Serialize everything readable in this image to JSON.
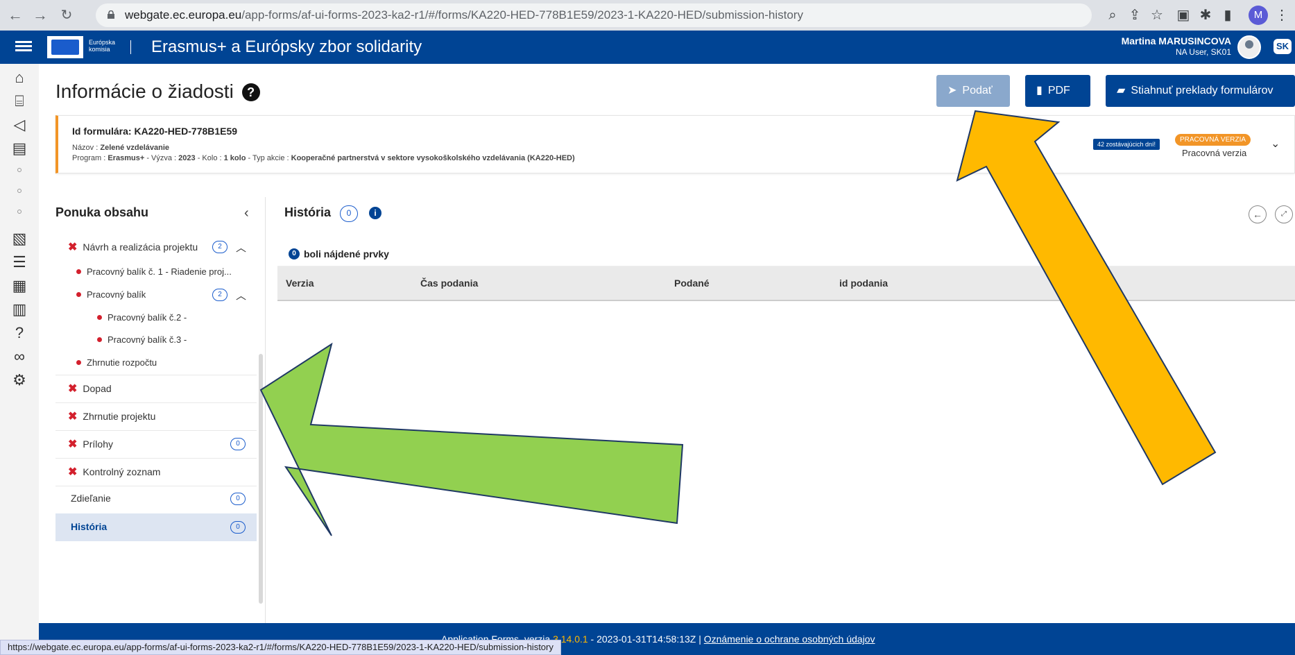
{
  "browser": {
    "url_host": "webgate.ec.europa.eu",
    "url_path": "/app-forms/af-ui-forms-2023-ka2-r1/#/forms/KA220-HED-778B1E59/2023-1-KA220-HED/submission-history",
    "profile_initial": "M",
    "status_url": "https://webgate.ec.europa.eu/app-forms/af-ui-forms-2023-ka2-r1/#/forms/KA220-HED-778B1E59/2023-1-KA220-HED/submission-history"
  },
  "header": {
    "logo_line1": "Európska",
    "logo_line2": "komisia",
    "app_title": "Erasmus+ a Európsky zbor solidarity",
    "user_name": "Martina MARUSINCOVA",
    "user_role": "NA User, SK01",
    "language": "SK"
  },
  "page": {
    "title": "Informácie o žiadosti",
    "help_icon": "?"
  },
  "actions": {
    "submit_label": "Podať",
    "pdf_label": "PDF",
    "translate_label": "Stiahnuť preklady formulárov"
  },
  "form_info": {
    "id_label": "Id formulára: KA220-HED-778B1E59",
    "name_prefix": "Názov : ",
    "name_value": "Zelené vzdelávanie",
    "program_prefix": "Program : ",
    "program_value": "Erasmus+",
    "call_prefix": " - Výzva : ",
    "call_value": "2023",
    "round_prefix": " - Kolo : ",
    "round_value": "1 kolo",
    "action_prefix": " - Typ akcie : ",
    "action_value": "Kooperačné partnerstvá v sektore vysokoškolského vzdelávania (KA220-HED)",
    "days_left": "42 zostávajúcich dní!",
    "status_badge": "PRACOVNÁ VERZIA",
    "status_text": "Pracovná verzia"
  },
  "menu": {
    "title": "Ponuka obsahu",
    "items": [
      {
        "label": "Návrh a realizácia projektu",
        "count": "2"
      },
      {
        "label": "Pracovný balík č. 1 - Riadenie proj..."
      },
      {
        "label": "Pracovný balík",
        "count": "2"
      },
      {
        "label": "Pracovný balík č.2 -"
      },
      {
        "label": "Pracovný balík č.3 -"
      },
      {
        "label": "Zhrnutie rozpočtu"
      },
      {
        "label": "Dopad"
      },
      {
        "label": "Zhrnutie projektu"
      },
      {
        "label": "Prílohy",
        "count": "0"
      },
      {
        "label": "Kontrolný zoznam"
      },
      {
        "label": "Zdieľanie",
        "count": "0"
      },
      {
        "label": "História",
        "count": "0"
      }
    ]
  },
  "history": {
    "title": "História",
    "count": "0",
    "found_count": "0",
    "found_text": "boli nájdené prvky",
    "columns": [
      "Verzia",
      "Čas podania",
      "Podané",
      "id podania"
    ]
  },
  "footer": {
    "text_prefix": "Application Forms, verzia ",
    "version": "3.14.0.1",
    "text_middle": " - 2023-01-31T14:58:13Z  |  ",
    "link": "Oznámenie o ochrane osobných údajov"
  },
  "colors": {
    "brand_blue": "#004494",
    "warning_orange": "#f29527",
    "error_red": "#d3202d",
    "arrow_green": "#92d050",
    "arrow_yellow": "#ffb900"
  }
}
